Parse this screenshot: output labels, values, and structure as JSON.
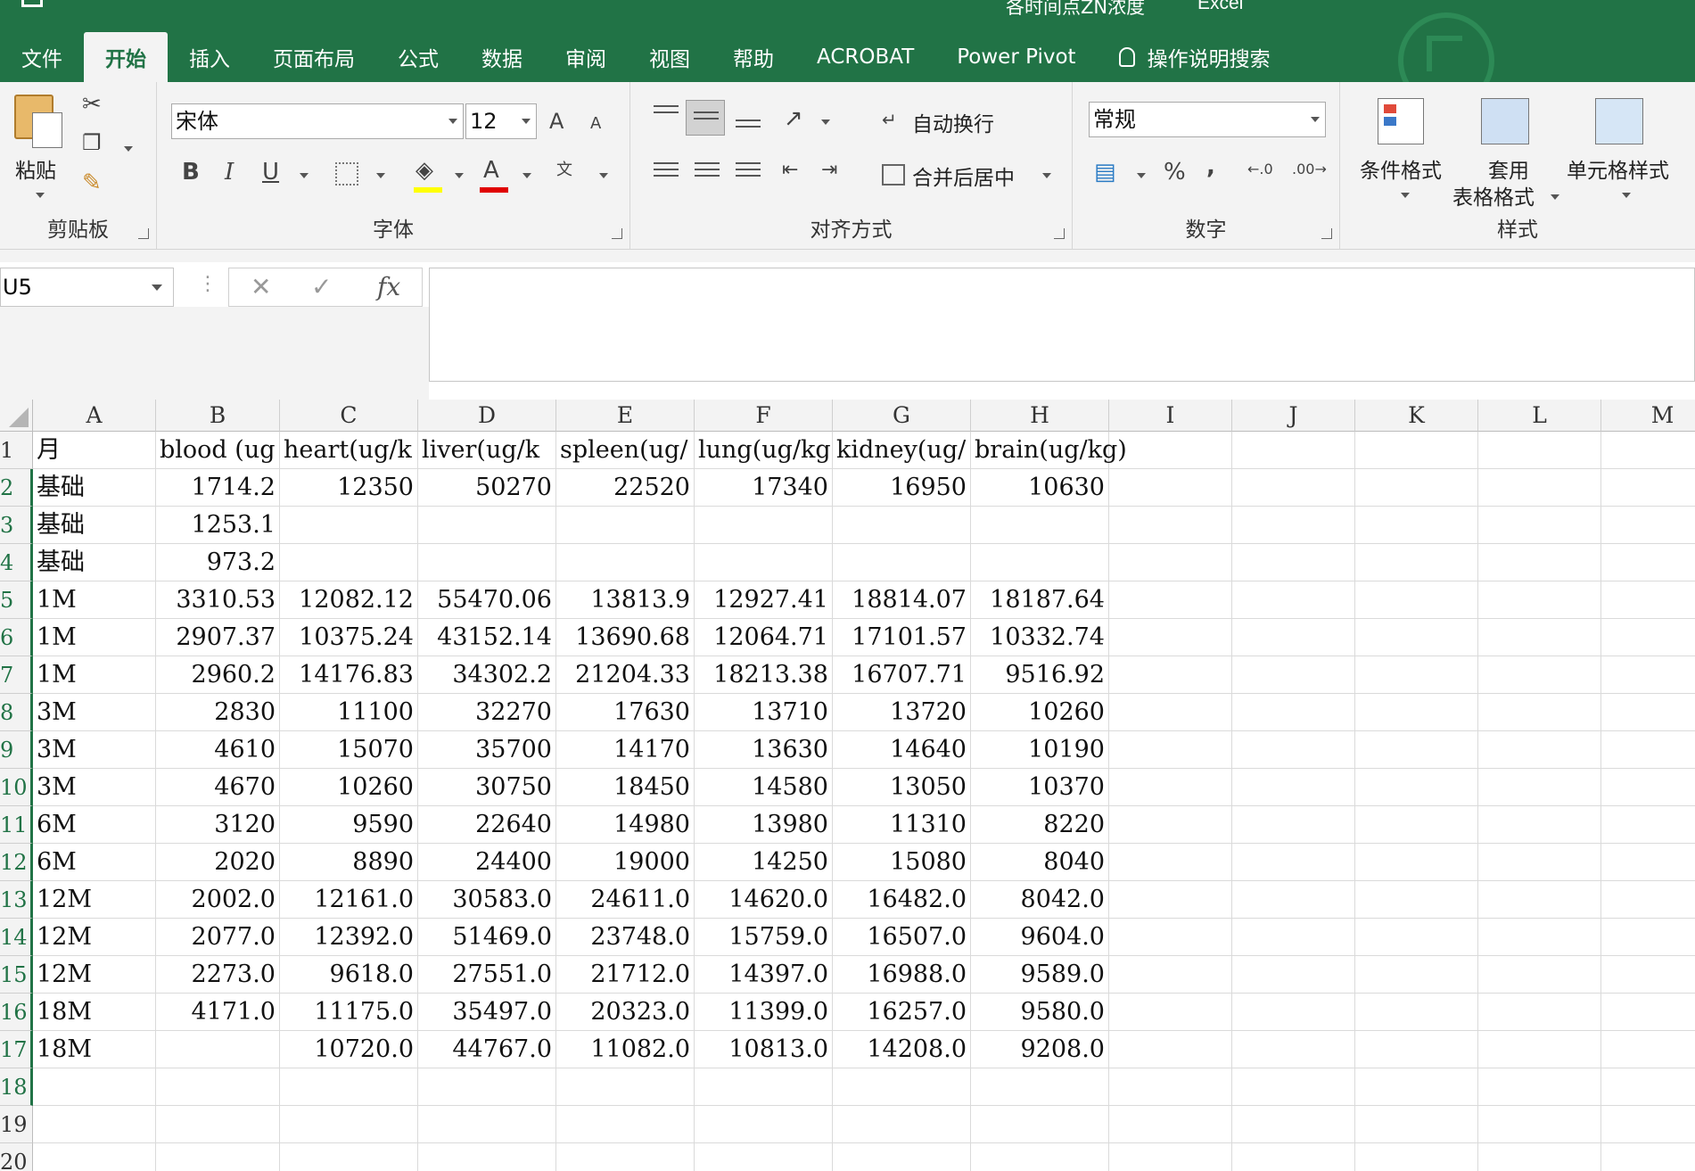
{
  "window": {
    "title": "各时间点ZN浓度",
    "app": "Excel"
  },
  "tabs": [
    "文件",
    "开始",
    "插入",
    "页面布局",
    "公式",
    "数据",
    "审阅",
    "视图",
    "帮助",
    "ACROBAT",
    "Power Pivot",
    "操作说明搜索"
  ],
  "ribbon": {
    "clipboard": {
      "paste": "粘贴",
      "group": "剪贴板"
    },
    "font": {
      "name": "宋体",
      "size": "12",
      "group": "字体",
      "bold": "B",
      "italic": "I",
      "underline": "U",
      "grow": "A",
      "shrink": "A",
      "color": "A"
    },
    "align": {
      "wrap": "自动换行",
      "merge": "合并后居中",
      "group": "对齐方式"
    },
    "number": {
      "format": "常规",
      "group": "数字",
      "percent": "%",
      "comma": ","
    },
    "styles": {
      "conditional": "条件格式",
      "table1": "套用",
      "table2": "表格格式",
      "cell": "单元格样式",
      "group": "样式"
    }
  },
  "formula_bar": {
    "name_box": "U5",
    "fx": "fx",
    "value": ""
  },
  "columns": [
    "A",
    "B",
    "C",
    "D",
    "E",
    "F",
    "G",
    "H",
    "I",
    "J",
    "K",
    "L",
    "M"
  ],
  "rows": [
    [
      "月",
      "blood (ug",
      "heart(ug/k",
      "liver(ug/k",
      "spleen(ug/",
      "lung(ug/kg",
      "kidney(ug/",
      "brain(ug/kg)"
    ],
    [
      "基础",
      "1714.2",
      "12350",
      "50270",
      "22520",
      "17340",
      "16950",
      "10630"
    ],
    [
      "基础",
      "1253.1",
      "",
      "",
      "",
      "",
      "",
      ""
    ],
    [
      "基础",
      "973.2",
      "",
      "",
      "",
      "",
      "",
      ""
    ],
    [
      "1M",
      "3310.53",
      "12082.12",
      "55470.06",
      "13813.9",
      "12927.41",
      "18814.07",
      "18187.64"
    ],
    [
      "1M",
      "2907.37",
      "10375.24",
      "43152.14",
      "13690.68",
      "12064.71",
      "17101.57",
      "10332.74"
    ],
    [
      "1M",
      "2960.2",
      "14176.83",
      "34302.2",
      "21204.33",
      "18213.38",
      "16707.71",
      "9516.92"
    ],
    [
      "3M",
      "2830",
      "11100",
      "32270",
      "17630",
      "13710",
      "13720",
      "10260"
    ],
    [
      "3M",
      "4610",
      "15070",
      "35700",
      "14170",
      "13630",
      "14640",
      "10190"
    ],
    [
      "3M",
      "4670",
      "10260",
      "30750",
      "18450",
      "14580",
      "13050",
      "10370"
    ],
    [
      "6M",
      "3120",
      "9590",
      "22640",
      "14980",
      "13980",
      "11310",
      "8220"
    ],
    [
      "6M",
      "2020",
      "8890",
      "24400",
      "19000",
      "14250",
      "15080",
      "8040"
    ],
    [
      "12M",
      "2002.0",
      "12161.0",
      "30583.0",
      "24611.0",
      "14620.0",
      "16482.0",
      "8042.0"
    ],
    [
      "12M",
      "2077.0",
      "12392.0",
      "51469.0",
      "23748.0",
      "15759.0",
      "16507.0",
      "9604.0"
    ],
    [
      "12M",
      "2273.0",
      "9618.0",
      "27551.0",
      "21712.0",
      "14397.0",
      "16988.0",
      "9589.0"
    ],
    [
      "18M",
      "4171.0",
      "11175.0",
      "35497.0",
      "20323.0",
      "11399.0",
      "16257.0",
      "9580.0"
    ],
    [
      "18M",
      "",
      "10720.0",
      "44767.0",
      "11082.0",
      "10813.0",
      "14208.0",
      "9208.0"
    ],
    [
      "",
      "",
      "",
      "",
      "",
      "",
      "",
      ""
    ],
    [
      "",
      "",
      "",
      "",
      "",
      "",
      "",
      ""
    ],
    [
      "",
      "",
      "",
      "",
      "",
      "",
      "",
      ""
    ]
  ],
  "row_numbers": [
    "1",
    "2",
    "3",
    "4",
    "5",
    "6",
    "7",
    "8",
    "9",
    "10",
    "11",
    "12",
    "13",
    "14",
    "15",
    "16",
    "17",
    "18",
    "19",
    "20"
  ],
  "colors": {
    "accent": "#217346",
    "ribbon": "#f3f3f3",
    "grid_line": "#dadada"
  }
}
